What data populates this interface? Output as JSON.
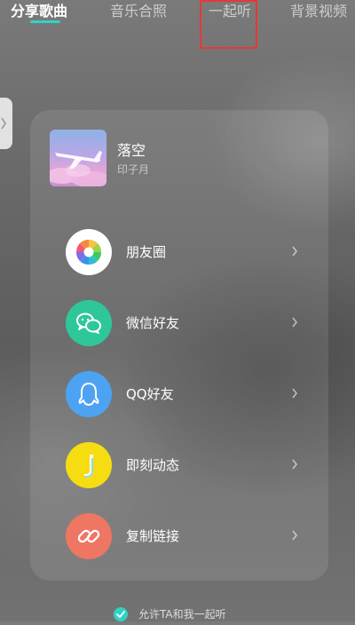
{
  "tabs": [
    {
      "label": "分享歌曲",
      "active": true
    },
    {
      "label": "音乐合照",
      "active": false
    },
    {
      "label": "一起听",
      "active": false
    },
    {
      "label": "背景视频",
      "active": false
    }
  ],
  "song": {
    "title": "落空",
    "artist": "印子月"
  },
  "share_options": [
    {
      "label": "朋友圈",
      "icon": "moments-icon",
      "color": "#ffffff"
    },
    {
      "label": "微信好友",
      "icon": "wechat-icon",
      "color": "#2ec79a"
    },
    {
      "label": "QQ好友",
      "icon": "qq-icon",
      "color": "#4da3f2"
    },
    {
      "label": "即刻动态",
      "icon": "jike-icon",
      "color": "#f5dd11"
    },
    {
      "label": "复制链接",
      "icon": "link-icon",
      "color": "#ee7663"
    }
  ],
  "allow_listen": {
    "label": "允许TA和我一起听",
    "checked": true
  },
  "colors": {
    "accent": "#2fd3c6",
    "highlight_box": "#e53935"
  }
}
